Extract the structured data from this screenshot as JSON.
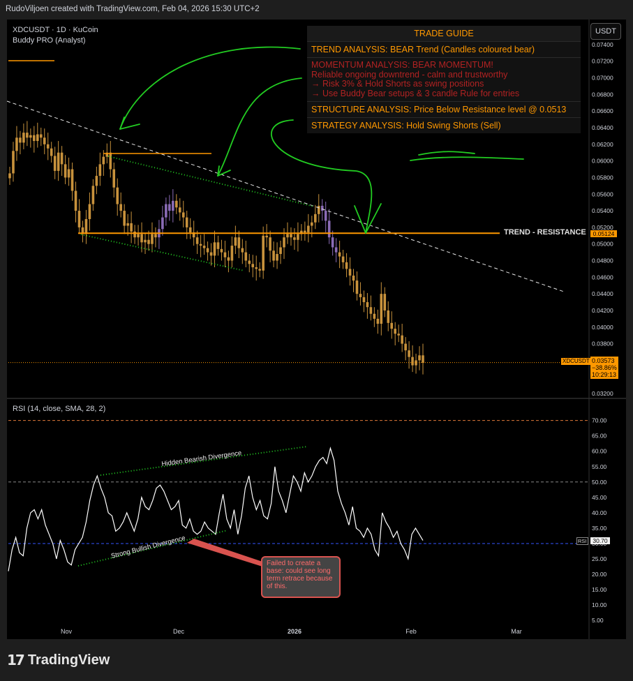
{
  "header": {
    "text": "RudoViljoen created with TradingView.com, Feb 04, 2026 15:30 UTC+2"
  },
  "symbol": {
    "line1": "XDCUSDT · 1D · KuCoin",
    "line2": "Buddy PRO (Analyst)"
  },
  "currency_button": "USDT",
  "trade_guide": {
    "title": "TRADE GUIDE",
    "trend": "TREND ANALYSIS: BEAR Trend (Candles coloured bear)",
    "momentum": [
      "MOMENTUM ANALYSIS: BEAR MOMENTUM!",
      " Reliable ongoing downtrend - calm and trustworthy",
      "→ Risk 3% & Hold Shorts as swing positions",
      "→ Use Buddy Bear setups & 3 candle Rule for entries"
    ],
    "structure": "STRUCTURE ANALYSIS: Price Below Resistance level @ 0.0513",
    "strategy": "STRATEGY ANALYSIS: Hold Swing Shorts (Sell)"
  },
  "resistance_label": "TREND - RESISTANCE",
  "resistance_tag": "0.05124",
  "price_tag": {
    "symbol": "XDCUSDT",
    "price": "0.03573",
    "change": "−38.86%",
    "countdown": "10:29:13"
  },
  "rsi": {
    "title": "RSI (14, close, SMA, 28, 2)",
    "value_tag": "30.70",
    "tag_label": "RSI",
    "annotations": {
      "hidden": "Hidden Bearish Divergence",
      "strong": "Strong Bullish Divergence"
    },
    "callout": "Failed to create a base: could see long term retrace because of this."
  },
  "logo": {
    "mark": "17",
    "word": "TradingView"
  },
  "colors": {
    "bear": "#8a6bb6",
    "bull": "#c8923c",
    "resistance": "#ff9800",
    "rsi_line": "#ffffff",
    "green": "#22cc22"
  },
  "chart_data": [
    {
      "type": "candlestick",
      "title": "XDCUSDT · 1D · KuCoin",
      "x_ticks": [
        "Nov",
        "Dec",
        "2026",
        "Feb",
        "Mar"
      ],
      "y_ticks": [
        "0.07400",
        "0.07200",
        "0.07000",
        "0.06800",
        "0.06600",
        "0.06400",
        "0.06200",
        "0.06000",
        "0.05800",
        "0.05600",
        "0.05400",
        "0.05200",
        "0.05000",
        "0.04800",
        "0.04600",
        "0.04400",
        "0.04200",
        "0.04000",
        "0.03800",
        "0.03600",
        "0.03400",
        "0.03200"
      ],
      "ylim": [
        0.0315,
        0.075
      ],
      "resistance": 0.0513,
      "last_price": 0.03573,
      "closes": [
        0.0585,
        0.0612,
        0.0628,
        0.0622,
        0.0634,
        0.0628,
        0.0631,
        0.0624,
        0.0632,
        0.0628,
        0.062,
        0.0615,
        0.0606,
        0.0588,
        0.061,
        0.0596,
        0.058,
        0.059,
        0.0564,
        0.054,
        0.052,
        0.0512,
        0.053,
        0.0548,
        0.057,
        0.0582,
        0.0596,
        0.0605,
        0.061,
        0.059,
        0.0568,
        0.0548,
        0.054,
        0.0522,
        0.0525,
        0.0515,
        0.0508,
        0.0512,
        0.0502,
        0.0505,
        0.05,
        0.0512,
        0.0508,
        0.0518,
        0.0532,
        0.0548,
        0.054,
        0.0552,
        0.0544,
        0.0538,
        0.0532,
        0.052,
        0.0514,
        0.0508,
        0.05,
        0.0498,
        0.0495,
        0.049,
        0.0486,
        0.0502,
        0.0494,
        0.049,
        0.0484,
        0.048,
        0.0498,
        0.0508,
        0.0495,
        0.049,
        0.048,
        0.0476,
        0.0472,
        0.047,
        0.0468,
        0.051,
        0.0508,
        0.0492,
        0.048,
        0.0488,
        0.0496,
        0.0508,
        0.0512,
        0.0508,
        0.0505,
        0.0512,
        0.0516,
        0.0514,
        0.0522,
        0.0526,
        0.0536,
        0.0546,
        0.054,
        0.0528,
        0.0508,
        0.0496,
        0.049,
        0.0485,
        0.0478,
        0.047,
        0.0462,
        0.0456,
        0.044,
        0.0436,
        0.043,
        0.0424,
        0.0416,
        0.041,
        0.0404,
        0.044,
        0.042,
        0.0405,
        0.0398,
        0.0392,
        0.039,
        0.038,
        0.0372,
        0.0364,
        0.0354,
        0.036,
        0.0366,
        0.0357
      ]
    },
    {
      "type": "line",
      "title": "RSI (14, close, SMA, 28, 2)",
      "y_ticks": [
        "70.00",
        "65.00",
        "60.00",
        "55.00",
        "50.00",
        "45.00",
        "40.00",
        "35.00",
        "30.00",
        "25.00",
        "20.00",
        "15.00",
        "10.00",
        "5.00"
      ],
      "ylim": [
        3,
        74
      ],
      "bands": [
        70,
        50,
        30
      ],
      "last_value": 30.7,
      "values": [
        21,
        28,
        32,
        27,
        26,
        35,
        40,
        41,
        38,
        41,
        36,
        33,
        30,
        25,
        31,
        28,
        24,
        23,
        28,
        30,
        32,
        37,
        44,
        49,
        52,
        48,
        45,
        40,
        39,
        34,
        35,
        37,
        40,
        37,
        34,
        38,
        45,
        42,
        41,
        44,
        48,
        49,
        47,
        44,
        41,
        42,
        44,
        36,
        35,
        38,
        34,
        33,
        34,
        37,
        35,
        34,
        33,
        40,
        46,
        38,
        35,
        41,
        33,
        39,
        48,
        52,
        45,
        41,
        44,
        39,
        38,
        43,
        55,
        47,
        44,
        40,
        46,
        52,
        50,
        47,
        53,
        50,
        52,
        55,
        57,
        58,
        56,
        61,
        57,
        47,
        43,
        40,
        36,
        42,
        35,
        34,
        32,
        35,
        33,
        28,
        26,
        40,
        37,
        35,
        32,
        34,
        30,
        28,
        25,
        33,
        35,
        33,
        31
      ]
    }
  ]
}
